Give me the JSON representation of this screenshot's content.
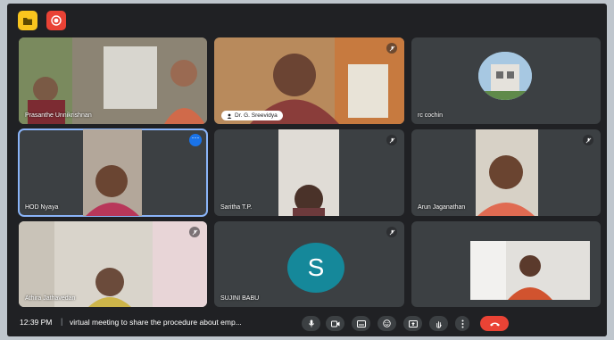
{
  "top_controls": {
    "folder_icon": "folder-icon",
    "record_icon": "record-icon"
  },
  "participants": [
    {
      "name": "Prasanthe Unnikrishnan",
      "muted": false
    },
    {
      "name": "Dr. G. Sreevidya",
      "muted": true
    },
    {
      "name": "rc cochin",
      "muted": false
    },
    {
      "name": "HOD Nyaya",
      "muted": false,
      "active": true
    },
    {
      "name": "Saritha T.P.",
      "muted": true
    },
    {
      "name": "Arun Jaganathan",
      "muted": true
    },
    {
      "name": "Athira Jathavedan",
      "muted": true
    },
    {
      "name": "SUJINI BABU",
      "muted": true
    },
    {
      "name": "",
      "muted": false
    }
  ],
  "avatar_letter": "S",
  "bottom_bar": {
    "time": "12:39 PM",
    "separator": "|",
    "meeting_title": "virtual meeting to share the procedure about emp..."
  },
  "colors": {
    "background": "#202124",
    "tile": "#3c4043",
    "end_call": "#ea4335",
    "accent": "#8ab4f8"
  }
}
